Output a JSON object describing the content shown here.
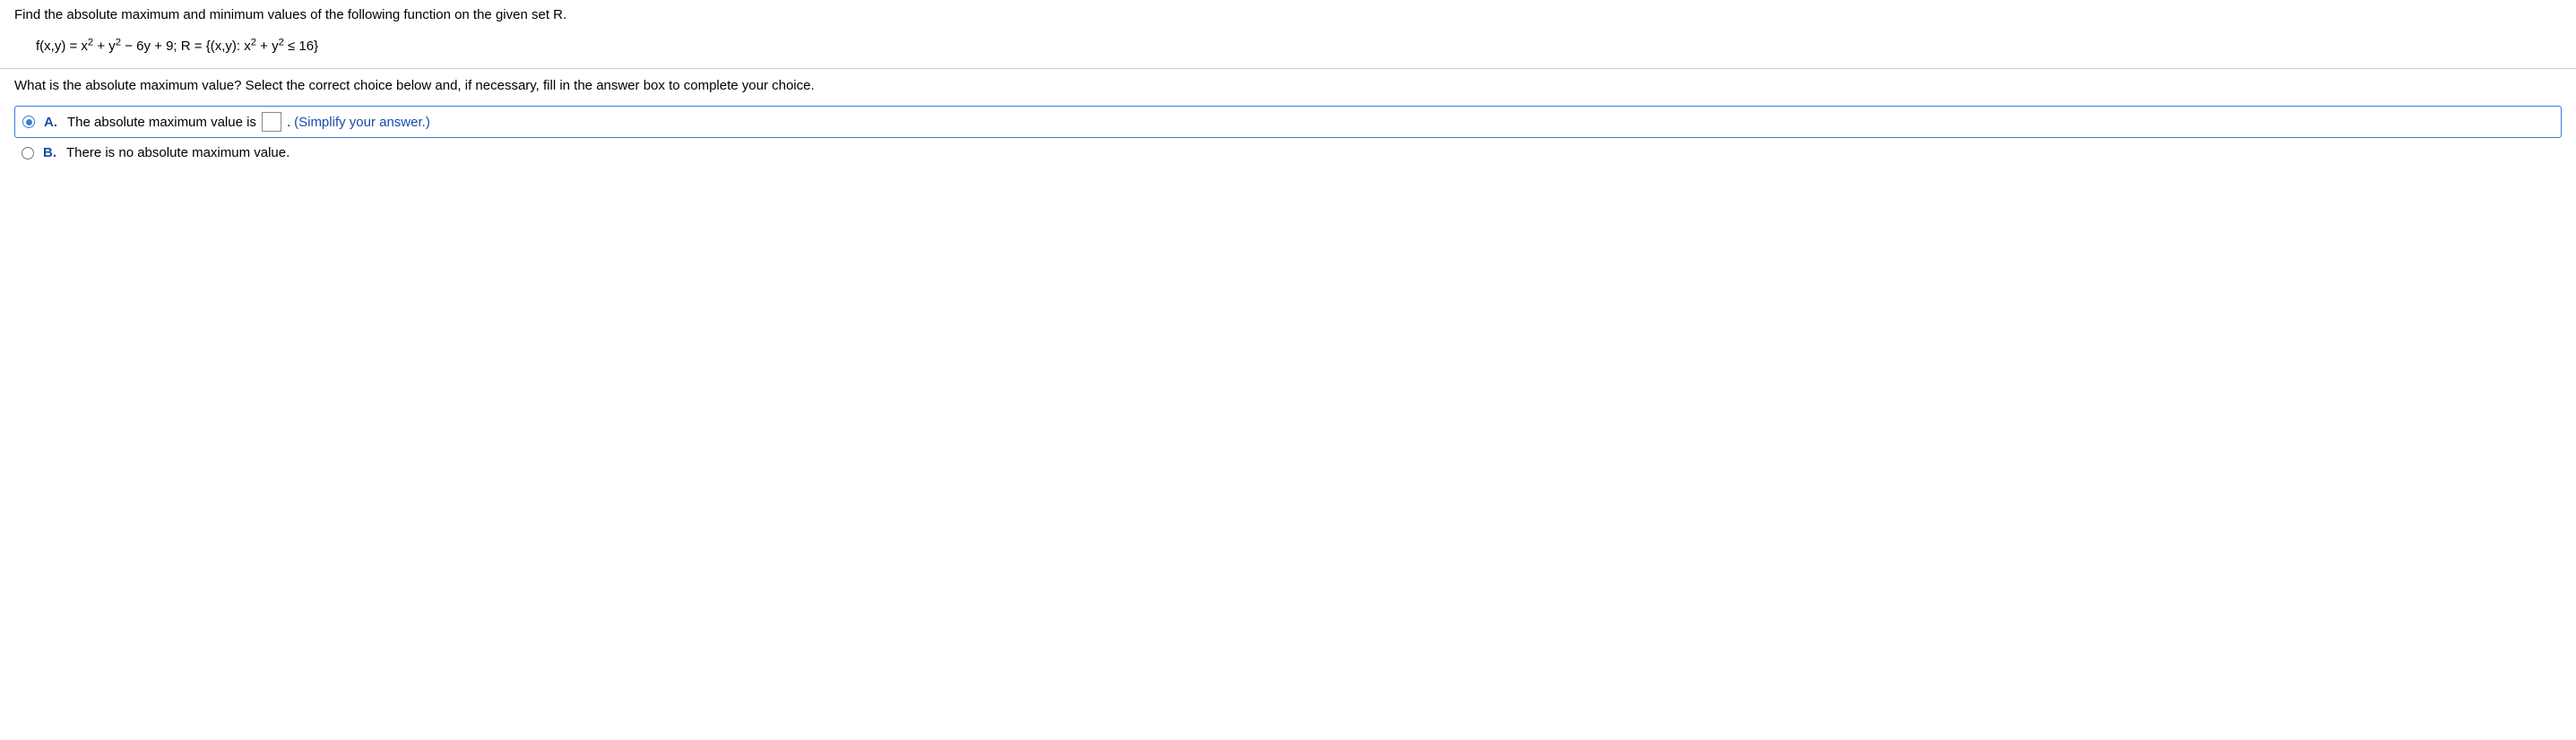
{
  "problem": {
    "intro": "Find the absolute maximum and minimum values of the following function on the given set R.",
    "formula_parts": {
      "p1": "f(x,y) = x",
      "e1": "2",
      "p2": " + y",
      "e2": "2",
      "p3": " − 6y + 9; R = {(x,y): x",
      "e3": "2",
      "p4": " + y",
      "e4": "2",
      "p5": " ≤ 16}"
    }
  },
  "question": "What is the absolute maximum value? Select the correct choice below and, if necessary, fill in the answer box to complete your choice.",
  "choices": {
    "a": {
      "letter": "A.",
      "text_before": "The absolute maximum value is ",
      "text_after": ".",
      "hint": " (Simplify your answer.)"
    },
    "b": {
      "letter": "B.",
      "text": "There is no absolute maximum value."
    }
  }
}
